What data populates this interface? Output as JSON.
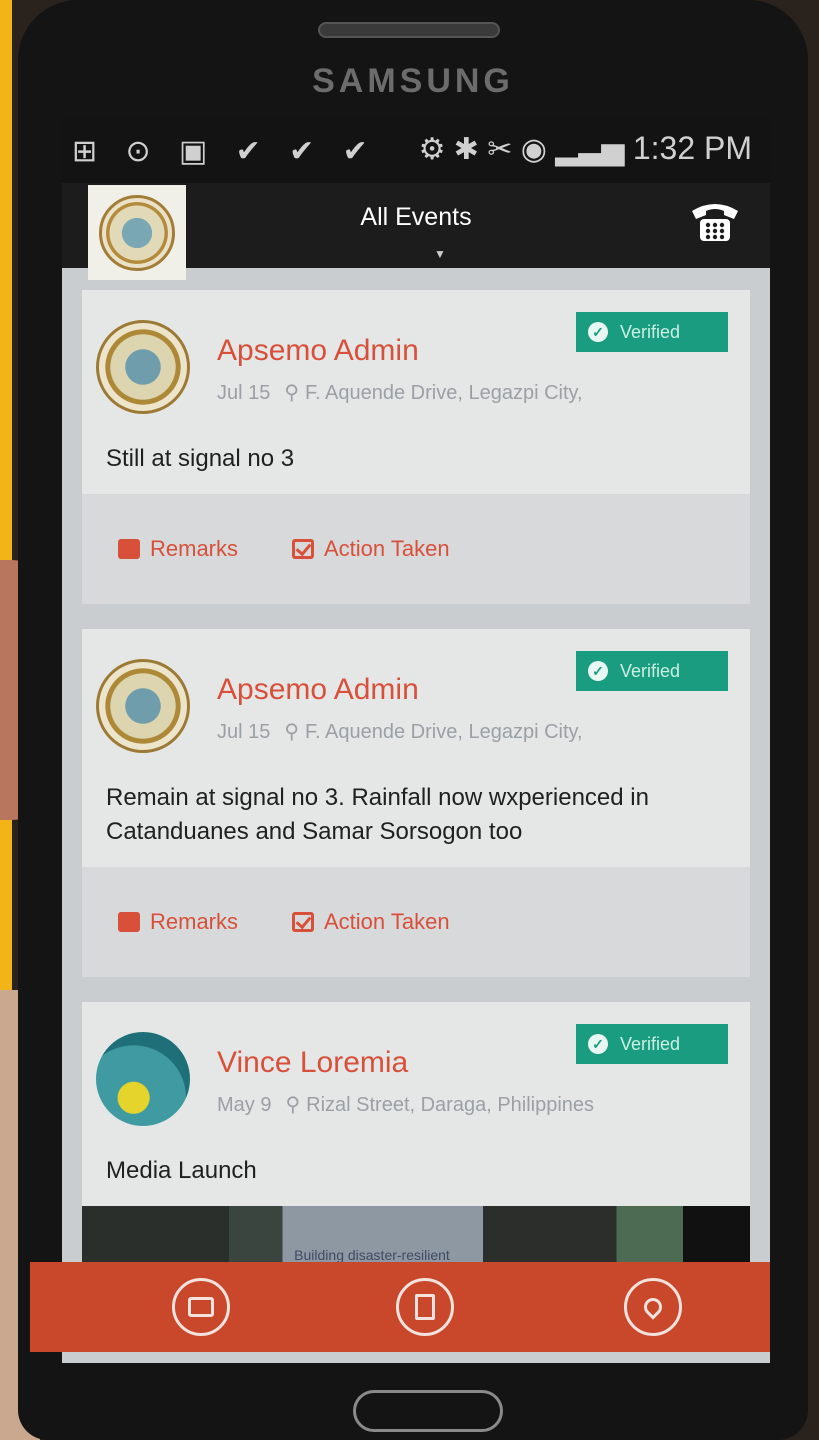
{
  "device": {
    "brand": "SAMSUNG"
  },
  "status_bar": {
    "left_icons": "⊞ ⊙ ▣ ✔ ✔ ✔",
    "right_icons": "⚙ ✱ ✂ ◉ ▂▃▅",
    "time": "1:32 PM"
  },
  "app_bar": {
    "title": "All Events",
    "logo": "province-seal-logo",
    "call_icon": "telephone-icon"
  },
  "posts": [
    {
      "author": "Apsemo Admin",
      "date": "Jul 15",
      "location": "F. Aquende Drive, Legazpi City,",
      "badge": "Verified",
      "text": "Still at signal no 3",
      "actions": {
        "remarks": "Remarks",
        "action_taken": "Action Taken"
      }
    },
    {
      "author": "Apsemo Admin",
      "date": "Jul 15",
      "location": "F. Aquende Drive, Legazpi City,",
      "badge": "Verified",
      "text": "Remain at signal no 3. Rainfall now wxperienced in Catanduanes and Samar Sorsogon too",
      "actions": {
        "remarks": "Remarks",
        "action_taken": "Action Taken"
      }
    },
    {
      "author": "Vince Loremia",
      "date": "May 9",
      "location": "Rizal Street, Daraga, Philippines",
      "badge": "Verified",
      "text": "Media Launch",
      "image_caption": "Building disaster-resilient communities"
    }
  ],
  "bottom_nav": [
    {
      "icon": "first-aid-kit-icon"
    },
    {
      "icon": "report-document-icon"
    },
    {
      "icon": "location-pin-icon"
    }
  ],
  "colors": {
    "accent": "#d8503a",
    "verified": "#1a9c80",
    "nav": "#c9482c"
  }
}
